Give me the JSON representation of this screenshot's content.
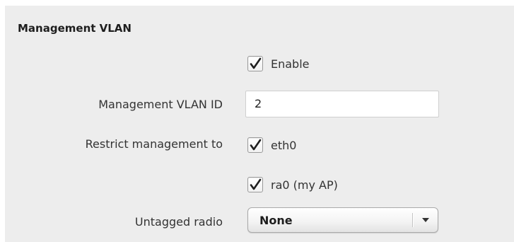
{
  "section": {
    "title": "Management VLAN"
  },
  "enable": {
    "label": "Enable",
    "checked": true
  },
  "vlan_id": {
    "label": "Management VLAN ID",
    "value": "2"
  },
  "restrict": {
    "label": "Restrict management to",
    "options": [
      {
        "label": "eth0",
        "checked": true
      },
      {
        "label": "ra0 (my AP)",
        "checked": true
      }
    ]
  },
  "untagged_radio": {
    "label": "Untagged radio",
    "selected": "None"
  },
  "icons": {
    "checkmark": "checkmark-icon",
    "dropdown": "triangle-down-icon"
  },
  "colors": {
    "panel_background": "#ededed",
    "checkmark": "#1f1f1f"
  }
}
